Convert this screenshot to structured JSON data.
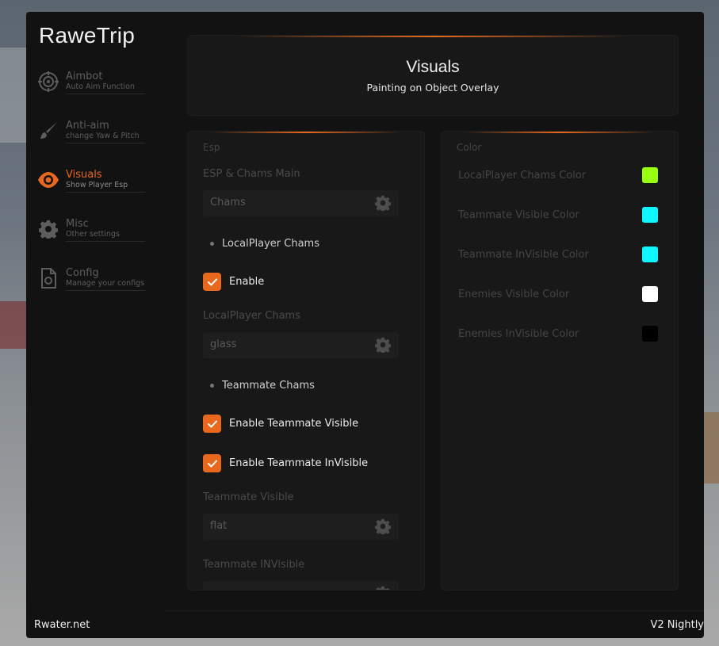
{
  "app": {
    "title": "RaweTrip",
    "footer_left": "Rwater.net",
    "footer_right": "V2 Nightly"
  },
  "sidebar": {
    "items": [
      {
        "title": "Aimbot",
        "sub": "Auto Aim Function",
        "icon": "crosshair-icon",
        "active": false
      },
      {
        "title": "Anti-aim",
        "sub": "change Yaw & Pitch",
        "icon": "brush-icon",
        "active": false
      },
      {
        "title": "Visuals",
        "sub": "Show Player Esp",
        "icon": "eye-icon",
        "active": true
      },
      {
        "title": "Misc",
        "sub": "Other settings",
        "icon": "gear-icon",
        "active": false
      },
      {
        "title": "Config",
        "sub": "Manage your configs",
        "icon": "file-icon",
        "active": false
      }
    ]
  },
  "header": {
    "title": "Visuals",
    "subtitle": "Painting on Object Overlay"
  },
  "esp": {
    "panel_label": "Esp",
    "main_label": "ESP & Chams Main",
    "main_select": "Chams",
    "local_bullet": "LocalPlayer Chams",
    "enable_label": "Enable",
    "enable_checked": true,
    "local_label": "LocalPlayer Chams",
    "local_select": "glass",
    "team_bullet": "Teammate Chams",
    "team_visible_check": "Enable Teammate Visible",
    "team_invisible_check": "Enable Teammate InVisible",
    "team_visible_label": "Teammate Visible",
    "team_visible_select": "flat",
    "team_invisible_label": "Teammate INVisible"
  },
  "color": {
    "panel_label": "Color",
    "rows": [
      {
        "label": "LocalPlayer Chams Color",
        "color": "#99ff12"
      },
      {
        "label": "Teammate Visible Color",
        "color": "#0ff5ff"
      },
      {
        "label": "Teammate InVisible Color",
        "color": "#0ff5ff"
      },
      {
        "label": "Enemies Visible Color",
        "color": "#ffffff"
      },
      {
        "label": "Enemies InVisible Color",
        "color": "#000000"
      }
    ]
  },
  "theme": {
    "accent": "#e8681d"
  }
}
